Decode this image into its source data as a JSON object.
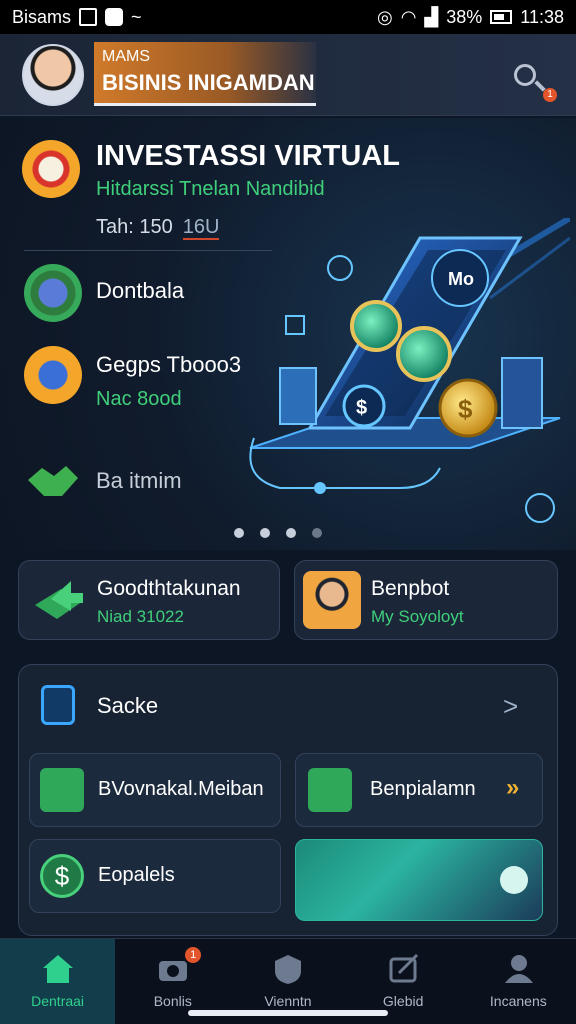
{
  "status_bar": {
    "carrier": "Bisams",
    "battery": "38%",
    "time": "11:38"
  },
  "header": {
    "subtitle": "MAMS",
    "title": "BISINIS INIGAMDAN",
    "notification_count": "1"
  },
  "hero": {
    "title": "INVESTASSI VIRTUAL",
    "subtitle": "Hitdarssi Tnelan Nandibid",
    "meta_label": "Tah: 150",
    "meta_value": "16U",
    "items": [
      {
        "label": "Dontbala",
        "sub": ""
      },
      {
        "label": "Gegps Tbooo3",
        "sub": "Nac 8ood"
      },
      {
        "label": "Ba itmim",
        "sub": ""
      }
    ],
    "phone_label": "Mo"
  },
  "cards": [
    {
      "title": "Goodthtakunan",
      "sub": "Niad 31022"
    },
    {
      "title": "Benpbot",
      "sub": "My Soyoloyt"
    }
  ],
  "panel": {
    "title": "Sacke",
    "tiles": [
      {
        "label": "BVovnakal.Meiban"
      },
      {
        "label": "Benpialamn"
      },
      {
        "label": "Eopalels"
      },
      {
        "label": ""
      }
    ]
  },
  "nav": [
    {
      "label": "Dentraai",
      "active": true
    },
    {
      "label": "Bonlis",
      "badge": "1"
    },
    {
      "label": "Vienntn"
    },
    {
      "label": "Glebid"
    },
    {
      "label": "Incanens"
    }
  ],
  "colors": {
    "accent_green": "#3fcf7a",
    "accent_orange": "#d07a2a",
    "accent_blue": "#3aa6ff",
    "badge": "#e3552a"
  }
}
